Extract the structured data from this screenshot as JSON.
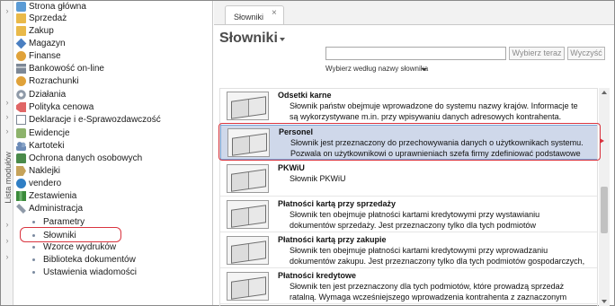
{
  "side_tab": {
    "label": "Lista modułów"
  },
  "nav": {
    "items": [
      {
        "label": "Strona główna",
        "icon": "home-icon"
      },
      {
        "label": "Sprzedaż",
        "icon": "folder-icon"
      },
      {
        "label": "Zakup",
        "icon": "folder-icon"
      },
      {
        "label": "Magazyn",
        "icon": "cube-icon"
      },
      {
        "label": "Finanse",
        "icon": "coin-icon"
      },
      {
        "label": "Bankowość on-line",
        "icon": "bank-icon"
      },
      {
        "label": "Rozrachunki",
        "icon": "coin-icon"
      },
      {
        "label": "Działania",
        "icon": "gear-icon"
      },
      {
        "label": "Polityka cenowa",
        "icon": "tag-icon"
      },
      {
        "label": "Deklaracje i e-Sprawozdawczość",
        "icon": "document-icon"
      },
      {
        "label": "Ewidencje",
        "icon": "card-icon"
      },
      {
        "label": "Kartoteki",
        "icon": "people-icon"
      },
      {
        "label": "Ochrona danych osobowych",
        "icon": "lock-icon"
      },
      {
        "label": "Naklejki",
        "icon": "label-icon"
      },
      {
        "label": "vendero",
        "icon": "vendero-icon"
      },
      {
        "label": "Zestawienia",
        "icon": "books-icon"
      },
      {
        "label": "Administracja",
        "icon": "wrench-icon"
      }
    ],
    "subitems": [
      {
        "label": "Parametry"
      },
      {
        "label": "Słowniki",
        "selected": true
      },
      {
        "label": "Wzorce wydruków"
      },
      {
        "label": "Biblioteka dokumentów"
      },
      {
        "label": "Ustawienia wiadomości"
      }
    ]
  },
  "tab": {
    "label": "Słowniki",
    "close": "×"
  },
  "page": {
    "title": "Słowniki",
    "search_value": "",
    "choose_button": "Wybierz teraz",
    "clear_button": "Wyczyść",
    "filter_label": "Wybierz według nazwy słownika"
  },
  "dictionaries": [
    {
      "title": "Odsetki karne",
      "desc1": "Słownik państw obejmuje wprowadzone do systemu nazwy krajów. Informacje te",
      "desc2": "są wykorzystywane m.in. przy wpisywaniu danych adresowych kontrahenta."
    },
    {
      "title": "Personel",
      "desc1": "Słownik jest przeznaczony do przechowywania danych o użytkownikach systemu.",
      "desc2": "Pozwala on użytkownikowi o uprawnieniach szefa firmy zdefiniować podstawowe",
      "selected": true
    },
    {
      "title": "PKWiU",
      "desc1": "Słownik PKWiU",
      "desc2": ""
    },
    {
      "title": "Płatności kartą przy sprzedaży",
      "desc1": "Słownik ten obejmuje płatności kartami kredytowymi przy wystawianiu",
      "desc2": "dokumentów sprzedaży. Jest przeznaczony tylko dla tych podmiotów"
    },
    {
      "title": "Płatności kartą przy zakupie",
      "desc1": "Słownik ten obejmuje płatności kartami kredytowymi przy wprowadzaniu",
      "desc2": "dokumentów zakupu. Jest przeznaczony tylko dla tych podmiotów gospodarczych,"
    },
    {
      "title": "Płatności kredytowe",
      "desc1": "Słownik ten jest przeznaczony dla tych podmiotów, które prowadzą sprzedaż",
      "desc2": "ratalną. Wymaga wcześniejszego wprowadzenia kontrahenta z zaznaczonym"
    }
  ],
  "colors": {
    "highlight": "#d9343f",
    "selected_row": "#cfd8ea"
  }
}
